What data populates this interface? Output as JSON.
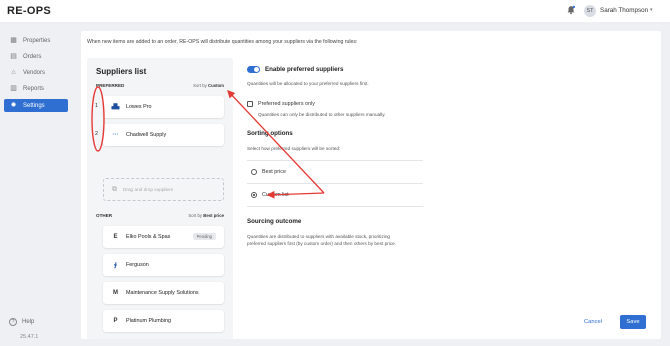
{
  "header": {
    "logo_left": "RE",
    "logo_dot": "-",
    "logo_right": "OPS",
    "user_initials": "ST",
    "user_name": "Sarah Thompson",
    "user_chevron": "▾"
  },
  "sidebar": {
    "items": [
      {
        "label": "Properties",
        "icon": "building-icon"
      },
      {
        "label": "Orders",
        "icon": "document-icon"
      },
      {
        "label": "Vendors",
        "icon": "store-icon"
      },
      {
        "label": "Reports",
        "icon": "report-icon"
      },
      {
        "label": "Settings",
        "icon": "gear-icon",
        "active": true
      }
    ],
    "help_label": "Help",
    "version": "25.47.1"
  },
  "main": {
    "intro": "When new items are added to an order, RE-OPS will distribute quantities among your suppliers via the following rules:",
    "suppliers_list": {
      "title": "Suppliers list",
      "preferred_heading": "PREFERRED",
      "preferred_sort_prefix": "Sort by",
      "preferred_sort_value": "Custom",
      "preferred": [
        {
          "rank": "1",
          "name": "Lowes Pro",
          "icon": "lowes-logo-icon"
        },
        {
          "rank": "2",
          "name": "Chadwell Supply",
          "icon": "chadwell-logo-icon"
        }
      ],
      "dropzone": "Drag and drop suppliers",
      "other_heading": "OTHER",
      "other_sort_prefix": "Sort by",
      "other_sort_value": "Best price",
      "other": [
        {
          "letter": "E",
          "name": "Elko Pools & Spas",
          "badge": "Pending"
        },
        {
          "letter": "",
          "name": "Ferguson",
          "icon": "ferguson-logo-icon"
        },
        {
          "letter": "M",
          "name": "Maintenance Supply Solutions"
        },
        {
          "letter": "P",
          "name": "Platinum Plumbing"
        }
      ]
    },
    "settings": {
      "enable_preferred_label": "Enable preferred suppliers",
      "enable_preferred_on": true,
      "enable_preferred_desc": "Quantities will be allocated to your preferred suppliers first.",
      "preferred_only_label": "Preferred suppliers only",
      "preferred_only_desc": "Quantities can only be distributed to other suppliers manually.",
      "sorting_title": "Sorting options",
      "sorting_desc": "Select how preferred suppliers will be sorted:",
      "sorting_options": [
        {
          "label": "Best price",
          "selected": false
        },
        {
          "label": "Custom list",
          "selected": true
        }
      ],
      "outcome_title": "Sourcing outcome",
      "outcome_desc_line1": "Quantities are distributed to suppliers with available stock, prioritizing",
      "outcome_desc_line2": "preferred suppliers first (by custom order) and then others by best price."
    },
    "cancel_label": "Cancel",
    "save_label": "Save"
  },
  "colors": {
    "accent": "#2f6fd1",
    "annotation": "#e53935",
    "sidebar_active": "#2f6fd1"
  }
}
